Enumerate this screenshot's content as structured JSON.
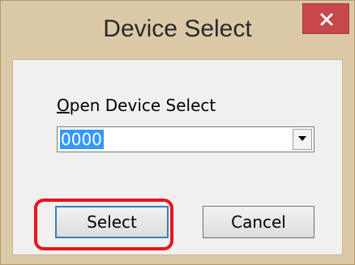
{
  "window": {
    "title": "Device Select",
    "close_label": "close"
  },
  "form": {
    "label_mnemonic": "O",
    "label_rest": "pen Device Select",
    "combo_value": "0000"
  },
  "buttons": {
    "select_label": "Select",
    "cancel_label": "Cancel"
  },
  "colors": {
    "frame": "#dbc9a8",
    "close_button": "#c7474a",
    "selection": "#3399ff",
    "highlight": "#e8141c"
  },
  "icons": {
    "close": "close-icon",
    "dropdown": "chevron-down-icon"
  }
}
